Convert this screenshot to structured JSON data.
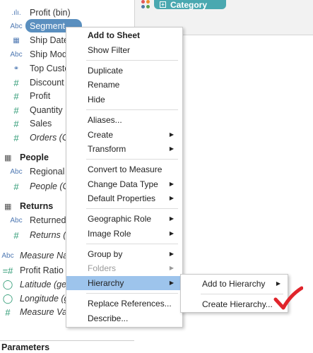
{
  "data_pane": {
    "fields": [
      {
        "icon": ".ılı.",
        "label": "Profit (bin)",
        "italic": false
      },
      {
        "icon": "Abc",
        "label": "Segment",
        "italic": false,
        "selected": true
      },
      {
        "icon": "calendar-icon",
        "label": "Ship Date",
        "italic": false
      },
      {
        "icon": "Abc",
        "label": "Ship Mod",
        "italic": false
      },
      {
        "icon": "set-icon",
        "label": "Top Custo",
        "italic": false
      },
      {
        "icon": "#",
        "label": "Discount",
        "italic": false
      },
      {
        "icon": "#",
        "label": "Profit",
        "italic": false
      },
      {
        "icon": "#",
        "label": "Quantity",
        "italic": false
      },
      {
        "icon": "#",
        "label": "Sales",
        "italic": false
      },
      {
        "icon": "#",
        "label": "Orders (C",
        "italic": true
      }
    ],
    "people_header": "People",
    "people_fields": [
      {
        "icon": "Abc",
        "label": "Regional M",
        "italic": false
      },
      {
        "icon": "#",
        "label": "People (C",
        "italic": true
      }
    ],
    "returns_header": "Returns",
    "returns_fields": [
      {
        "icon": "Abc",
        "label": "Returned",
        "italic": false
      },
      {
        "icon": "#",
        "label": "Returns (",
        "italic": true
      }
    ],
    "other_fields": [
      {
        "icon": "Abc",
        "label": "Measure Na",
        "italic": true
      },
      {
        "icon": "=#",
        "label": "Profit Ratio",
        "italic": false
      },
      {
        "icon": "globe-icon",
        "label": "Latitude (ge",
        "italic": true
      },
      {
        "icon": "globe-icon",
        "label": "Longitude (g",
        "italic": true
      },
      {
        "icon": "#",
        "label": "Measure Va",
        "italic": true
      }
    ],
    "parameters_header": "Parameters"
  },
  "shelf": {
    "pill_label": "Category",
    "dot_colors": [
      "#e15759",
      "#f28e2b",
      "#4e79a7"
    ]
  },
  "context_menu": {
    "items": [
      {
        "label": "Add to Sheet",
        "bold": true
      },
      {
        "label": "Show Filter"
      },
      {
        "label": "Duplicate"
      },
      {
        "label": "Rename"
      },
      {
        "label": "Hide"
      },
      {
        "label": "Aliases..."
      },
      {
        "label": "Create",
        "submenu": true
      },
      {
        "label": "Transform",
        "submenu": true
      },
      {
        "label": "Convert to Measure"
      },
      {
        "label": "Change Data Type",
        "submenu": true
      },
      {
        "label": "Default Properties",
        "submenu": true
      },
      {
        "label": "Geographic Role",
        "submenu": true
      },
      {
        "label": "Image Role",
        "submenu": true
      },
      {
        "label": "Group by",
        "submenu": true
      },
      {
        "label": "Folders",
        "submenu": true,
        "disabled": true
      },
      {
        "label": "Hierarchy",
        "submenu": true,
        "highlighted": true
      },
      {
        "label": "Replace References..."
      },
      {
        "label": "Describe..."
      }
    ]
  },
  "submenu": {
    "items": [
      {
        "label": "Add to Hierarchy",
        "submenu": true
      },
      {
        "label": "Create Hierarchy..."
      }
    ]
  },
  "colors": {
    "highlight": "#9dc4ec",
    "selected_pill": "#5a8fbf",
    "category_pill": "#4aa8b0",
    "checkmark": "#e0242b"
  }
}
